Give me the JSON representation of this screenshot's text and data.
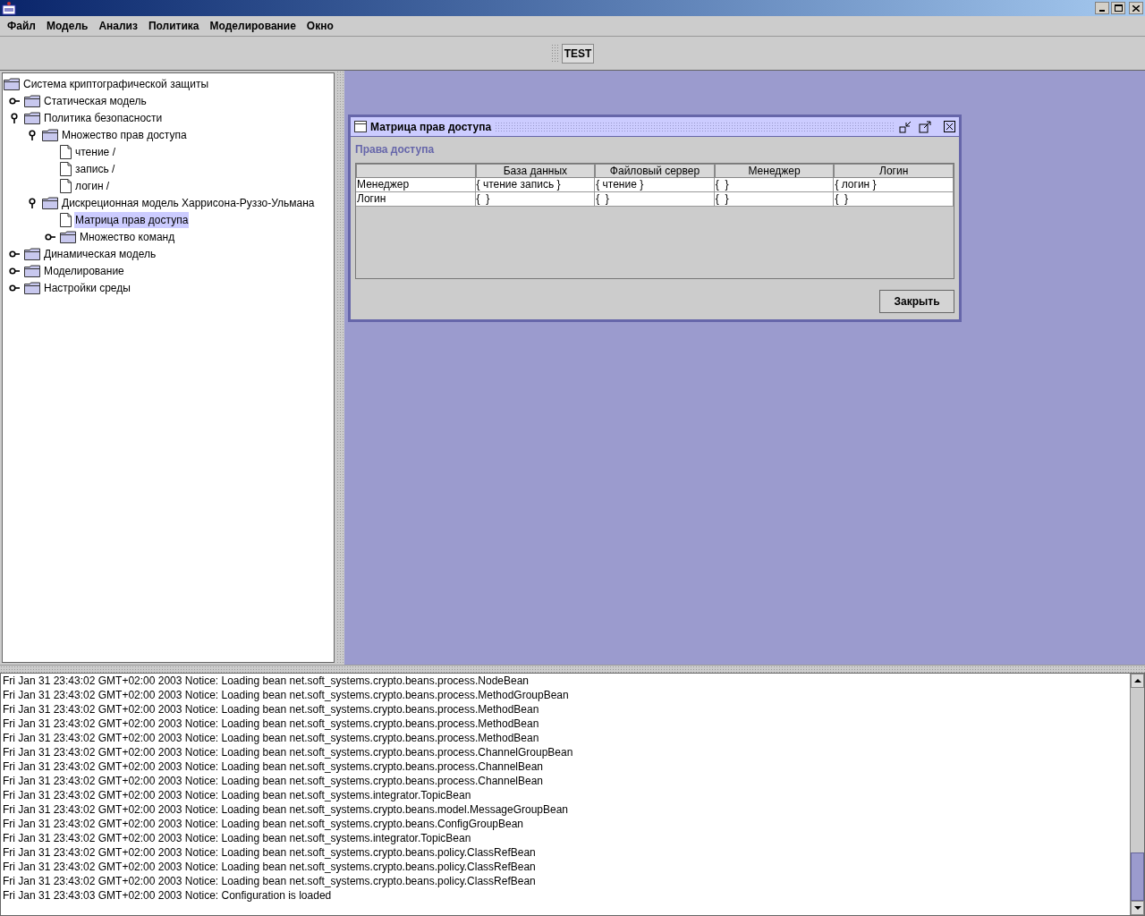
{
  "menu": [
    "Файл",
    "Модель",
    "Анализ",
    "Политика",
    "Моделирование",
    "Окно"
  ],
  "toolbar": {
    "button": "TEST"
  },
  "tree": [
    {
      "label": "Система криптографической защиты",
      "kind": "folder",
      "selected": false,
      "children": [
        {
          "label": "Статическая модель",
          "kind": "folder",
          "expanded": false,
          "selected": false
        },
        {
          "label": "Политика безопасности",
          "kind": "folder",
          "expanded": true,
          "selected": false,
          "children": [
            {
              "label": "Множество прав доступа",
              "kind": "folder",
              "expanded": true,
              "selected": false,
              "children": [
                {
                  "label": "чтение /",
                  "kind": "document",
                  "selected": false
                },
                {
                  "label": "запись /",
                  "kind": "document",
                  "selected": false
                },
                {
                  "label": "логин /",
                  "kind": "document",
                  "selected": false
                }
              ]
            },
            {
              "label": "Дискреционная модель Харрисона-Руззо-Ульмана",
              "kind": "folder",
              "expanded": true,
              "selected": false,
              "children": [
                {
                  "label": "Матрица прав доступа",
                  "kind": "document",
                  "selected": true
                },
                {
                  "label": "Множество команд",
                  "kind": "folder",
                  "expanded": false,
                  "selected": false
                }
              ]
            }
          ]
        },
        {
          "label": "Динамическая модель",
          "kind": "folder",
          "expanded": false,
          "selected": false
        },
        {
          "label": "Моделирование",
          "kind": "folder",
          "expanded": false,
          "selected": false
        },
        {
          "label": "Настройки среды",
          "kind": "folder",
          "expanded": false,
          "selected": false
        }
      ]
    }
  ],
  "internal_frame": {
    "title": "Матрица прав доступа",
    "section": "Права доступа",
    "table": {
      "columns": [
        "",
        "База данных",
        "Файловый сервер",
        "Менеджер",
        "Логин"
      ],
      "rows": [
        [
          "Менеджер",
          "{ чтение запись }",
          "{ чтение }",
          "{  }",
          "{ логин }"
        ],
        [
          "Логин",
          "{  }",
          "{  }",
          "{  }",
          "{  }"
        ]
      ]
    },
    "button": "Закрыть"
  },
  "log": [
    "Fri Jan 31 23:43:02 GMT+02:00 2003 Notice: Loading bean net.soft_systems.crypto.beans.process.NodeBean",
    "Fri Jan 31 23:43:02 GMT+02:00 2003 Notice: Loading bean net.soft_systems.crypto.beans.process.MethodGroupBean",
    "Fri Jan 31 23:43:02 GMT+02:00 2003 Notice: Loading bean net.soft_systems.crypto.beans.process.MethodBean",
    "Fri Jan 31 23:43:02 GMT+02:00 2003 Notice: Loading bean net.soft_systems.crypto.beans.process.MethodBean",
    "Fri Jan 31 23:43:02 GMT+02:00 2003 Notice: Loading bean net.soft_systems.crypto.beans.process.MethodBean",
    "Fri Jan 31 23:43:02 GMT+02:00 2003 Notice: Loading bean net.soft_systems.crypto.beans.process.ChannelGroupBean",
    "Fri Jan 31 23:43:02 GMT+02:00 2003 Notice: Loading bean net.soft_systems.crypto.beans.process.ChannelBean",
    "Fri Jan 31 23:43:02 GMT+02:00 2003 Notice: Loading bean net.soft_systems.crypto.beans.process.ChannelBean",
    "Fri Jan 31 23:43:02 GMT+02:00 2003 Notice: Loading bean net.soft_systems.integrator.TopicBean",
    "Fri Jan 31 23:43:02 GMT+02:00 2003 Notice: Loading bean net.soft_systems.crypto.beans.model.MessageGroupBean",
    "Fri Jan 31 23:43:02 GMT+02:00 2003 Notice: Loading bean net.soft_systems.crypto.beans.ConfigGroupBean",
    "Fri Jan 31 23:43:02 GMT+02:00 2003 Notice: Loading bean net.soft_systems.integrator.TopicBean",
    "Fri Jan 31 23:43:02 GMT+02:00 2003 Notice: Loading bean net.soft_systems.crypto.beans.policy.ClassRefBean",
    "Fri Jan 31 23:43:02 GMT+02:00 2003 Notice: Loading bean net.soft_systems.crypto.beans.policy.ClassRefBean",
    "Fri Jan 31 23:43:02 GMT+02:00 2003 Notice: Loading bean net.soft_systems.crypto.beans.policy.ClassRefBean",
    "Fri Jan 31 23:43:03 GMT+02:00 2003 Notice: Configuration is loaded"
  ]
}
